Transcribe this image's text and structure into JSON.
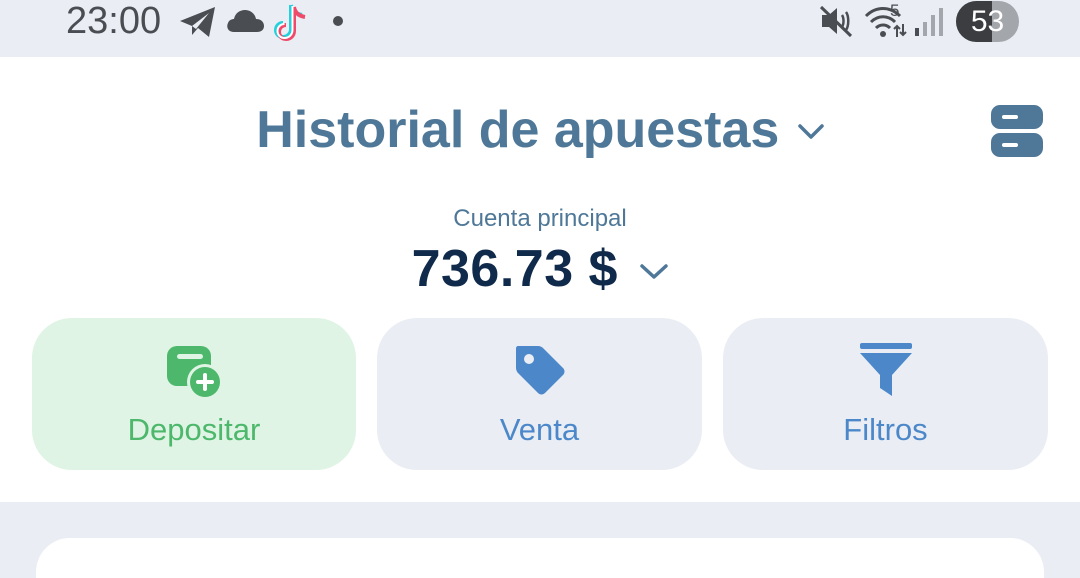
{
  "status_bar": {
    "time": "23:00",
    "icons": [
      "telegram-icon",
      "cloud-icon",
      "tiktok-icon",
      "notification-dot-icon"
    ],
    "right_icons": [
      "mute-icon",
      "wifi-icon",
      "signal-icon"
    ],
    "wifi_label": "5",
    "battery": "53",
    "battery_level_percent": 53
  },
  "header": {
    "title": "Historial de apuestas"
  },
  "account": {
    "label": "Cuenta principal",
    "balance": "736.73 $"
  },
  "actions": [
    {
      "label": "Depositar",
      "icon": "deposit-icon",
      "color": "#4db86b",
      "bg": "#dff4e4"
    },
    {
      "label": "Venta",
      "icon": "tag-icon",
      "color": "#4c88c9",
      "bg": "#eaeef4"
    },
    {
      "label": "Filtros",
      "icon": "filter-icon",
      "color": "#4c88c9",
      "bg": "#eaeef4"
    }
  ],
  "colors": {
    "title": "#4f7898",
    "balance": "#0f2a4a",
    "background": "#eaeef4"
  }
}
